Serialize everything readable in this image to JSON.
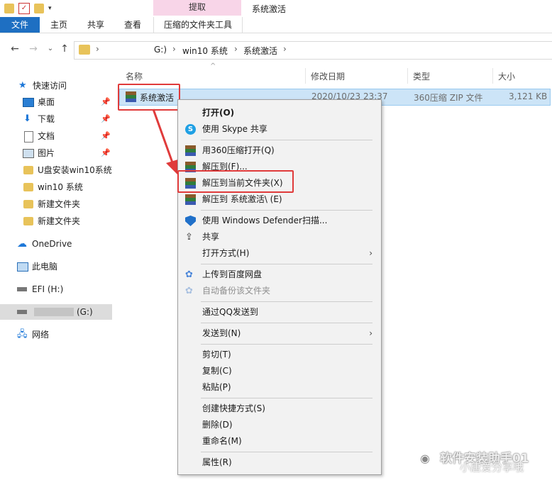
{
  "window": {
    "title": "系统激活",
    "context_tab_header": "提取"
  },
  "ribbon": {
    "tabs": [
      "文件",
      "主页",
      "共享",
      "查看",
      "压缩的文件夹工具"
    ]
  },
  "address": {
    "crumbs": [
      "G:)",
      "win10 系统",
      "系统激活"
    ]
  },
  "nav": {
    "quick_access": "快速访问",
    "items": [
      {
        "label": "桌面",
        "pinned": true
      },
      {
        "label": "下载",
        "pinned": true
      },
      {
        "label": "文档",
        "pinned": true
      },
      {
        "label": "图片",
        "pinned": true
      },
      {
        "label": "U盘安装win10系统",
        "pinned": false
      },
      {
        "label": "win10 系统",
        "pinned": false
      },
      {
        "label": "新建文件夹",
        "pinned": false
      },
      {
        "label": "新建文件夹",
        "pinned": false
      }
    ],
    "onedrive": "OneDrive",
    "this_pc": "此电脑",
    "efi": "EFI (H:)",
    "g_drive": "(G:)",
    "network": "网络",
    "pin_glyph": "📌"
  },
  "list": {
    "columns": [
      "名称",
      "修改日期",
      "类型",
      "大小"
    ],
    "file": {
      "name": "系统激活",
      "date": "2020/10/23 23:37",
      "type": "360压缩 ZIP 文件",
      "size": "3,121 KB"
    }
  },
  "menu": {
    "open": "打开(O)",
    "skype": "使用 Skype 共享",
    "open360": "用360压缩打开(Q)",
    "extract_to": "解压到(F)...",
    "extract_here": "解压到当前文件夹(X)",
    "extract_named": "解压到 系统激活\\ (E)",
    "defender": "使用 Windows Defender扫描...",
    "share": "共享",
    "open_with": "打开方式(H)",
    "baidu_upload": "上传到百度网盘",
    "baidu_backup": "自动备份该文件夹",
    "qq": "通过QQ发送到",
    "send_to": "发送到(N)",
    "cut": "剪切(T)",
    "copy": "复制(C)",
    "paste": "粘贴(P)",
    "shortcut": "创建快捷方式(S)",
    "delete": "删除(D)",
    "rename": "重命名(M)",
    "properties": "属性(R)"
  },
  "watermark": {
    "line1": "软件安装助手01",
    "line2": "小唐爱分享哦"
  },
  "colors": {
    "accent": "#1e6fc2",
    "selection": "#cce4f7",
    "highlight_red": "#e03b3b",
    "context_tab": "#f8d5e8"
  }
}
